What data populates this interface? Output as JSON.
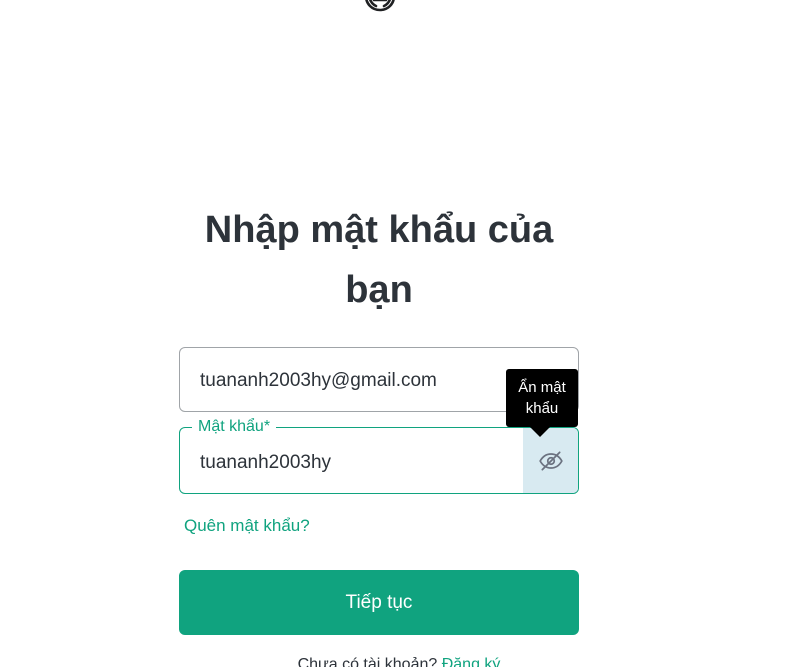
{
  "logo": {
    "icon": "openai-logo-icon"
  },
  "heading": {
    "line1": "Nhập mật khẩu của",
    "line2": "bạn"
  },
  "email_field": {
    "value": "tuananh2003hy@gmail.com"
  },
  "password_field": {
    "label": "Mật khẩu*",
    "value": "tuananh2003hy",
    "toggle_icon": "eye-off-icon"
  },
  "tooltip": {
    "line1": "Ẩn mật",
    "line2": "khẩu"
  },
  "forgot_password": {
    "label": "Quên mật khẩu?"
  },
  "continue_button": {
    "label": "Tiếp tục"
  },
  "signup": {
    "prompt": "Chưa có tài khoản?",
    "link": "Đăng ký"
  },
  "colors": {
    "accent": "#10a37f",
    "text": "#2d333a",
    "toggle_bg": "#d8eaf1",
    "tooltip_bg": "#000000"
  }
}
